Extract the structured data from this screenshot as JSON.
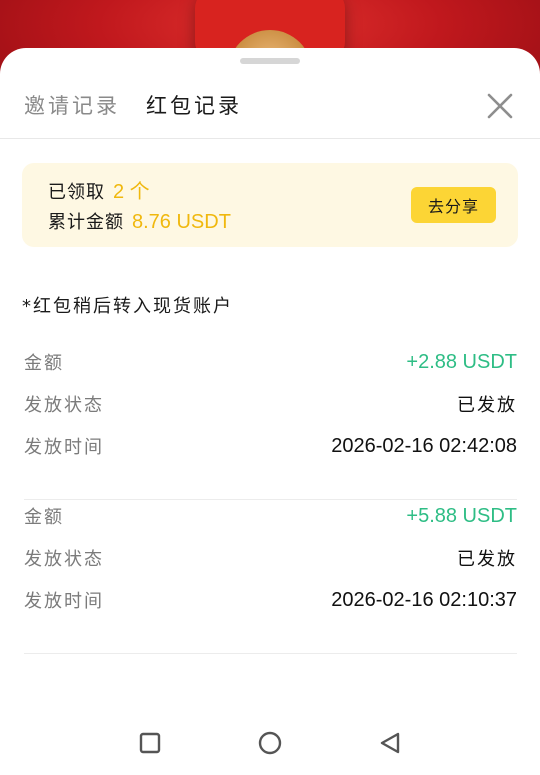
{
  "tabs": [
    {
      "label": "邀请记录",
      "active": false
    },
    {
      "label": "红包记录",
      "active": true
    }
  ],
  "summary": {
    "received_prefix": "已领取",
    "received_count": "2 个",
    "total_label": "累计金额",
    "total_amount": "8.76 USDT",
    "share_button": "去分享"
  },
  "note": "*红包稍后转入现货账户",
  "records": [
    {
      "amount_label": "金额",
      "amount": "+2.88 USDT",
      "status_label": "发放状态",
      "status": "已发放",
      "time_label": "发放时间",
      "time": "2026-02-16 02:42:08"
    },
    {
      "amount_label": "金额",
      "amount": "+5.88 USDT",
      "status_label": "发放状态",
      "status": "已发放",
      "time_label": "发放时间",
      "time": "2026-02-16 02:10:37"
    }
  ],
  "colors": {
    "accent_yellow": "#fcd535",
    "highlight_text": "#f0b80e",
    "positive_green": "#2ebd85",
    "summary_bg": "#fef8e3"
  },
  "icons": {
    "close": "close-icon",
    "nav_recents": "square-icon",
    "nav_home": "circle-icon",
    "nav_back": "triangle-back-icon"
  }
}
